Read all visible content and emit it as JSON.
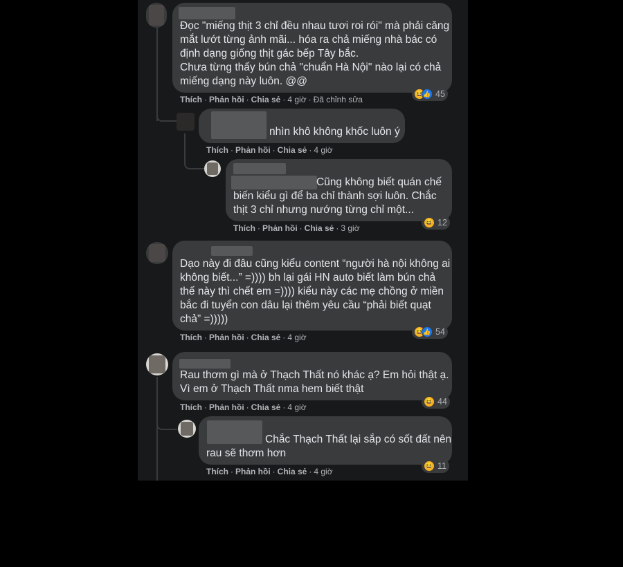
{
  "actions": {
    "like": "Thích",
    "reply": "Phản hồi",
    "share": "Chia sẻ",
    "dot": "·"
  },
  "comments": [
    {
      "lines": [
        "Đọc \"miếng thịt 3 chỉ đều nhau tươi roi rói\" mà phải căng",
        "mắt lướt từng ảnh mãi... hóa ra chả miếng nhà bác có",
        "định dạng giống thịt gác bếp Tây bắc.",
        "Chưa từng thấy bún chả \"chuẩn Hà Nội\" nào lại có chả",
        "miếng dạng này luôn. @@"
      ],
      "time": "4 giờ",
      "edited": "Đã chỉnh sửa",
      "reaction_count": "45"
    },
    {
      "lines": [
        "nhìn khô không khốc luôn ý"
      ],
      "time": "4 giờ"
    },
    {
      "lines": [
        "Cũng không biết quán chế",
        "biến kiểu gì để ba chỉ thành sợi luôn. Chắc",
        "thịt 3 chỉ nhưng nướng từng chỉ một..."
      ],
      "time": "3 giờ",
      "reaction_count": "12"
    },
    {
      "lines": [
        "Dạo này đi đâu cũng kiểu content “người hà nội không ai",
        "không biết...” =)))) bh lại gái HN auto biết làm bún chả",
        "thế này thì chết em =)))) kiểu này các mẹ chồng ở miền",
        "bắc đi tuyển con dâu lại thêm yêu cầu “phải biết quạt",
        "chả” =)))))"
      ],
      "time": "4 giờ",
      "reaction_count": "54"
    },
    {
      "lines": [
        "Rau thơm gì mà ở Thạch Thất nó khác ạ? Em hỏi thật ạ.",
        "Vì em ở Thạch Thất nma hem biết thật"
      ],
      "time": "4 giờ",
      "reaction_count": "44"
    },
    {
      "lines": [
        "Chắc Thạch Thất lại sắp có sốt đất nên",
        "rau sẽ thơm hơn"
      ],
      "time": "4 giờ",
      "reaction_count": "11"
    }
  ],
  "icons": {
    "haha": "haha-reaction-icon",
    "like": "like-reaction-icon"
  },
  "colors": {
    "bubble": "#3a3b3c",
    "text": "#e4e6eb",
    "muted": "#b0b3b8",
    "like": "#1877f2",
    "haha": "#f7b125"
  }
}
